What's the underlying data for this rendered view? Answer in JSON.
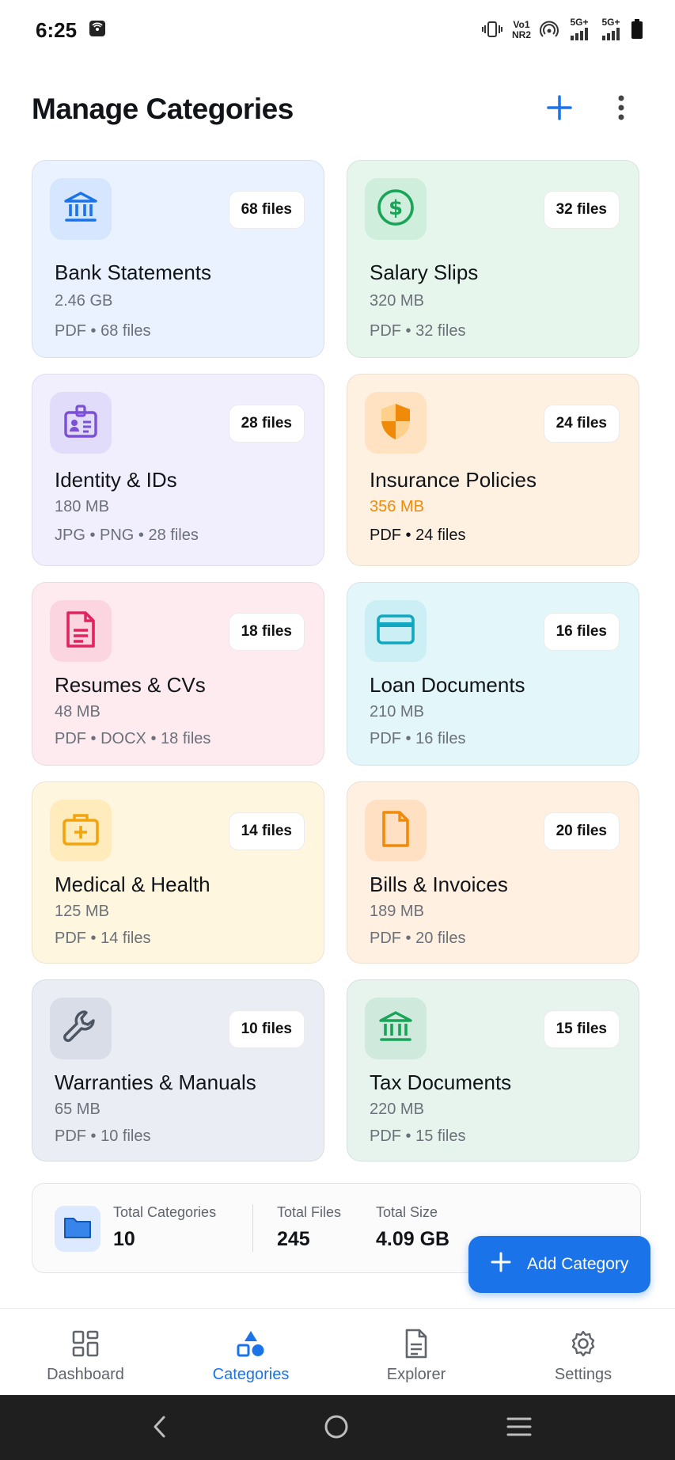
{
  "status_bar": {
    "time": "6:25",
    "net_top": "Vo1",
    "net_bottom": "NR2",
    "sig1": "5G+",
    "sig2": "5G+"
  },
  "header": {
    "title": "Manage Categories",
    "add_icon": "plus-icon",
    "menu_icon": "more-vertical-icon"
  },
  "categories": [
    {
      "title": "Bank Statements",
      "size": "2.46 GB",
      "meta": "PDF • 68 files",
      "count": "68 files",
      "icon": "bank-icon",
      "accent": "#1a73e8"
    },
    {
      "title": "Salary Slips",
      "size": "320 MB",
      "meta": "PDF • 32 files",
      "count": "32 files",
      "icon": "dollar-circle-icon",
      "accent": "#18a558"
    },
    {
      "title": "Identity & IDs",
      "size": "180 MB",
      "meta": "JPG • PNG • 28 files",
      "count": "28 files",
      "icon": "id-badge-icon",
      "accent": "#7b4fd6"
    },
    {
      "title": "Insurance Policies",
      "size": "356 MB",
      "meta": "PDF • 24 files",
      "count": "24 files",
      "icon": "shield-icon",
      "accent": "#f08b0a"
    },
    {
      "title": "Resumes & CVs",
      "size": "48 MB",
      "meta": "PDF • DOCX • 18 files",
      "count": "18 files",
      "icon": "document-icon",
      "accent": "#e0245e"
    },
    {
      "title": "Loan Documents",
      "size": "210 MB",
      "meta": "PDF • 16 files",
      "count": "16 files",
      "icon": "credit-card-icon",
      "accent": "#10a7bf"
    },
    {
      "title": "Medical & Health",
      "size": "125 MB",
      "meta": "PDF • 14 files",
      "count": "14 files",
      "icon": "medical-kit-icon",
      "accent": "#f2a40f"
    },
    {
      "title": "Bills & Invoices",
      "size": "189 MB",
      "meta": "PDF • 20 files",
      "count": "20 files",
      "icon": "file-icon",
      "accent": "#f08b0a"
    },
    {
      "title": "Warranties & Manuals",
      "size": "65 MB",
      "meta": "PDF • 10 files",
      "count": "10 files",
      "icon": "wrench-icon",
      "accent": "#4d5563"
    },
    {
      "title": "Tax Documents",
      "size": "220 MB",
      "meta": "PDF • 15 files",
      "count": "15 files",
      "icon": "bank-icon",
      "accent": "#18a558"
    }
  ],
  "summary": {
    "categories_label": "Total Categories",
    "categories_value": "10",
    "files_label": "Total Files",
    "files_value": "245",
    "size_label": "Total Size",
    "size_value": "4.09 GB",
    "icon": "folder-icon"
  },
  "fab": {
    "label": "Add Category",
    "icon": "plus-icon"
  },
  "bottom_nav": [
    {
      "label": "Dashboard",
      "icon": "dashboard-icon",
      "active": false
    },
    {
      "label": "Categories",
      "icon": "categories-icon",
      "active": true
    },
    {
      "label": "Explorer",
      "icon": "document-icon",
      "active": false
    },
    {
      "label": "Settings",
      "icon": "gear-icon",
      "active": false
    }
  ],
  "colors": {
    "primary": "#1a73e8",
    "text": "#111418",
    "muted": "#6b7079"
  }
}
